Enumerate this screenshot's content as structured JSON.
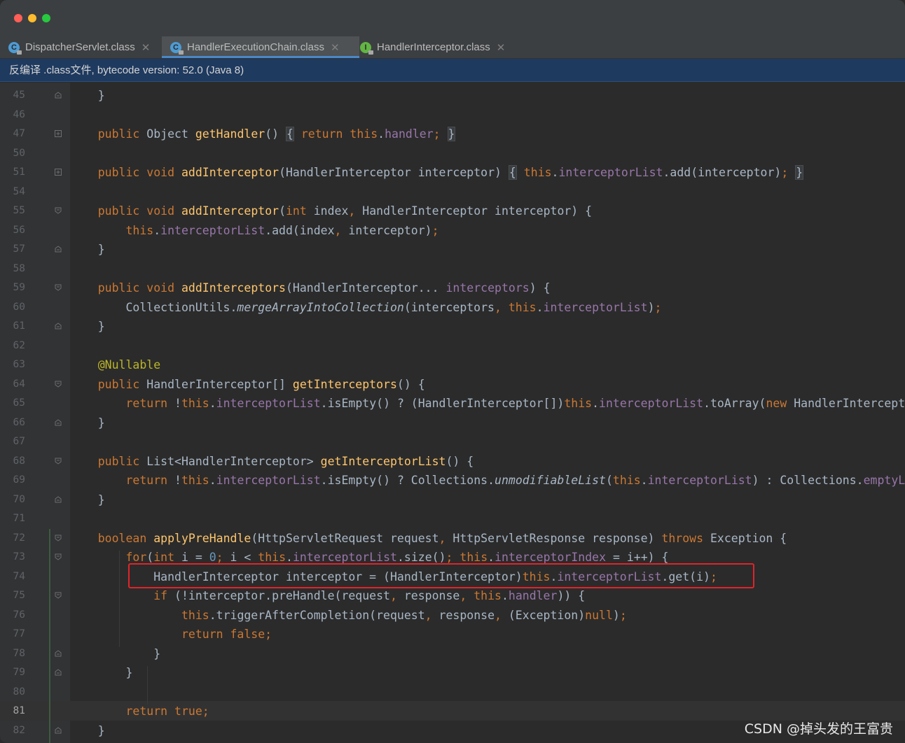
{
  "window": {
    "traffic_lights": [
      "close",
      "minimize",
      "maximize"
    ]
  },
  "tabs": [
    {
      "label": "DispatcherServlet.class",
      "icon": "class-icon",
      "active": false
    },
    {
      "label": "HandlerExecutionChain.class",
      "icon": "class-icon",
      "active": true
    },
    {
      "label": "HandlerInterceptor.class",
      "icon": "interface-icon",
      "active": false
    }
  ],
  "infobar": {
    "text": "反编译 .class文件, bytecode version: 52.0 (Java 8)"
  },
  "editor": {
    "current_line": 81,
    "highlighted_line": 74,
    "lines": [
      {
        "n": 45,
        "text": "    }"
      },
      {
        "n": 46,
        "text": ""
      },
      {
        "n": 47,
        "text": "    public Object getHandler() { return this.handler; }"
      },
      {
        "n": 50,
        "text": ""
      },
      {
        "n": 51,
        "text": "    public void addInterceptor(HandlerInterceptor interceptor) { this.interceptorList.add(interceptor); }"
      },
      {
        "n": 54,
        "text": ""
      },
      {
        "n": 55,
        "text": "    public void addInterceptor(int index, HandlerInterceptor interceptor) {"
      },
      {
        "n": 56,
        "text": "        this.interceptorList.add(index, interceptor);"
      },
      {
        "n": 57,
        "text": "    }"
      },
      {
        "n": 58,
        "text": ""
      },
      {
        "n": 59,
        "text": "    public void addInterceptors(HandlerInterceptor... interceptors) {"
      },
      {
        "n": 60,
        "text": "        CollectionUtils.mergeArrayIntoCollection(interceptors, this.interceptorList);"
      },
      {
        "n": 61,
        "text": "    }"
      },
      {
        "n": 62,
        "text": ""
      },
      {
        "n": 63,
        "text": "    @Nullable"
      },
      {
        "n": 64,
        "text": "    public HandlerInterceptor[] getInterceptors() {"
      },
      {
        "n": 65,
        "text": "        return !this.interceptorList.isEmpty() ? (HandlerInterceptor[])this.interceptorList.toArray(new HandlerIntercept"
      },
      {
        "n": 66,
        "text": "    }"
      },
      {
        "n": 67,
        "text": ""
      },
      {
        "n": 68,
        "text": "    public List<HandlerInterceptor> getInterceptorList() {"
      },
      {
        "n": 69,
        "text": "        return !this.interceptorList.isEmpty() ? Collections.unmodifiableList(this.interceptorList) : Collections.emptyL"
      },
      {
        "n": 70,
        "text": "    }"
      },
      {
        "n": 71,
        "text": ""
      },
      {
        "n": 72,
        "text": "    boolean applyPreHandle(HttpServletRequest request, HttpServletResponse response) throws Exception {"
      },
      {
        "n": 73,
        "text": "        for(int i = 0; i < this.interceptorList.size(); this.interceptorIndex = i++) {"
      },
      {
        "n": 74,
        "text": "            HandlerInterceptor interceptor = (HandlerInterceptor)this.interceptorList.get(i);"
      },
      {
        "n": 75,
        "text": "            if (!interceptor.preHandle(request, response, this.handler)) {"
      },
      {
        "n": 76,
        "text": "                this.triggerAfterCompletion(request, response, (Exception)null);"
      },
      {
        "n": 77,
        "text": "                return false;"
      },
      {
        "n": 78,
        "text": "            }"
      },
      {
        "n": 79,
        "text": "        }"
      },
      {
        "n": 80,
        "text": ""
      },
      {
        "n": 81,
        "text": "        return true;"
      },
      {
        "n": 82,
        "text": "    }"
      }
    ]
  },
  "watermark": "CSDN @掉头发的王富贵",
  "colors": {
    "background": "#2b2b2b",
    "keyword": "#cc7832",
    "method": "#ffc66d",
    "field": "#9876aa",
    "number": "#6897bb",
    "annotation": "#bbb529",
    "default_text": "#a9b7c6",
    "highlight_box": "#e0242a",
    "infobar": "#1f3a5f"
  }
}
